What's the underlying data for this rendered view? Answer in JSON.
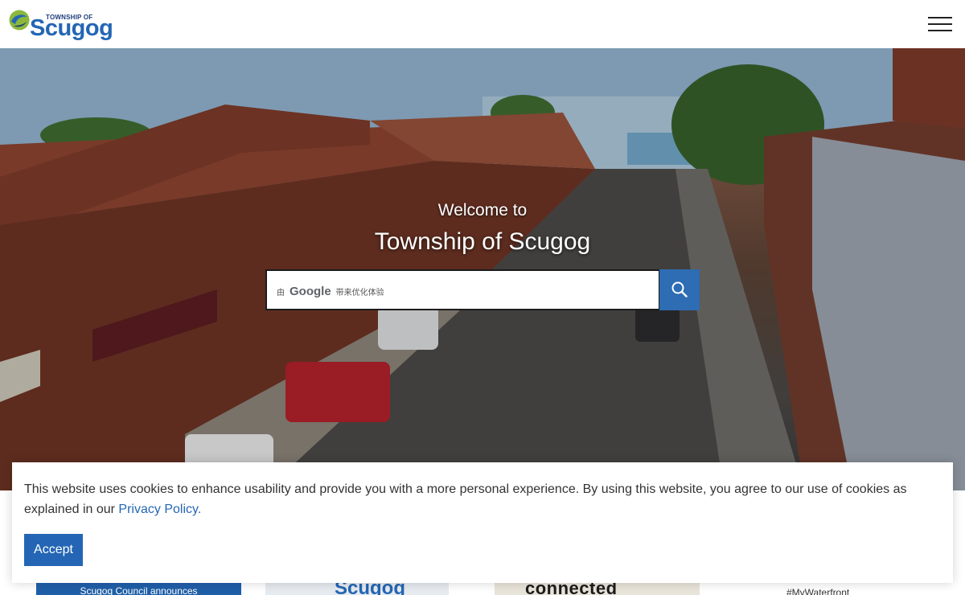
{
  "header": {
    "logo_small": "TOWNSHIP OF",
    "logo_main": "Scugog",
    "menu_icon": "hamburger-icon"
  },
  "hero": {
    "welcome": "Welcome to",
    "title": "Township of Scugog"
  },
  "search": {
    "by_label": "由",
    "google_label": "Google",
    "enhanced_label": "带来优化体验",
    "button_icon": "search-icon"
  },
  "cards": [
    {
      "label": "Scugog Council announces"
    },
    {
      "label": "Scugog"
    },
    {
      "label": "connected"
    },
    {
      "label": "#MyWaterfront"
    }
  ],
  "cookie": {
    "text": "This website uses cookies to enhance usability and provide you with a more personal experience. By using this website, you agree to our use of cookies as explained in our ",
    "link": "Privacy Policy.",
    "accept_label": "Accept"
  },
  "colors": {
    "brand_blue": "#2466b5",
    "logo_green": "#8bb83c"
  }
}
